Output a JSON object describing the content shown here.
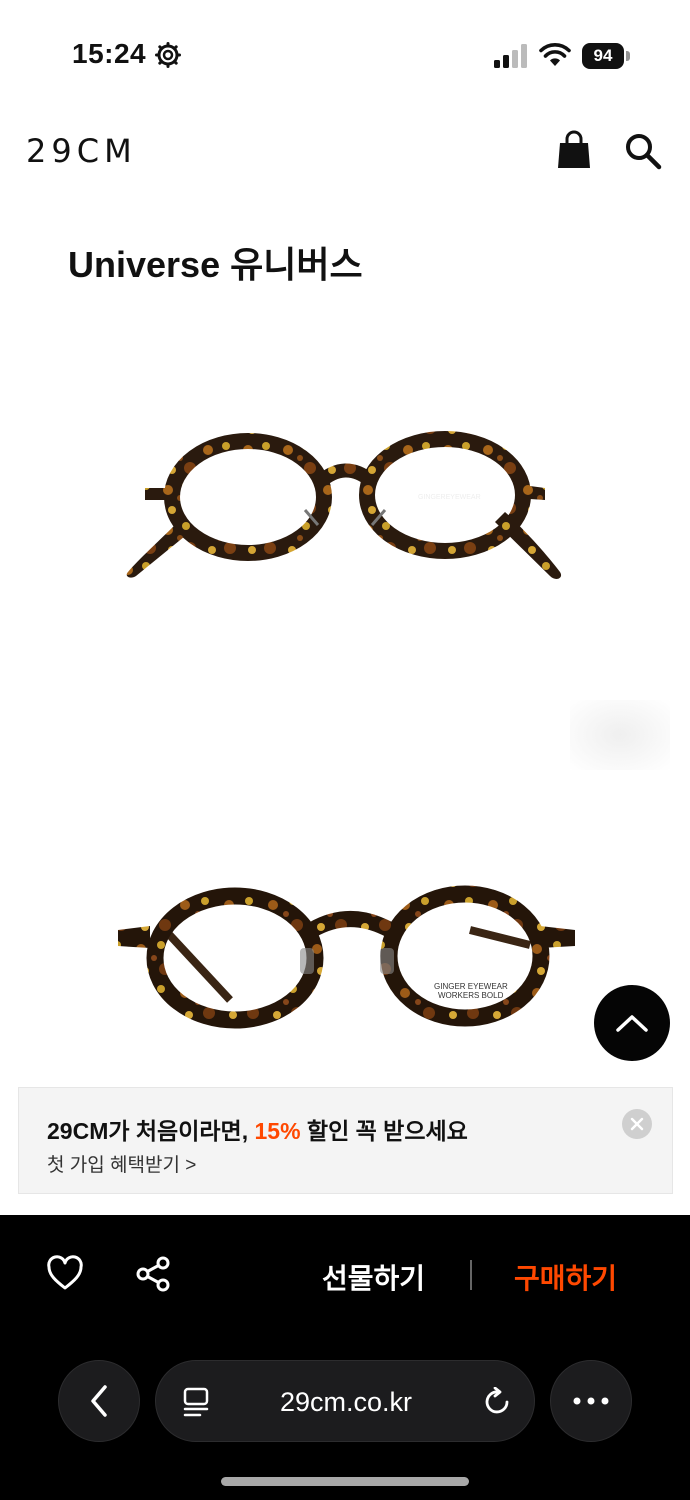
{
  "status_bar": {
    "time": "15:24",
    "battery": "94"
  },
  "header": {
    "logo": "29CM",
    "icons": [
      "shopping-bag-icon",
      "search-icon"
    ]
  },
  "product": {
    "title": "Universe 유니버스",
    "image_text_1": "GINGEREYEWEAR",
    "image_text_2a": "GINGER EYEWEAR",
    "image_text_2b": "WORKERS BOLD"
  },
  "promo": {
    "headline_prefix": "29CM가 처음이라면, ",
    "headline_highlight": "15%",
    "headline_suffix": " 할인 꼭 받으세요",
    "link": "첫 가입 혜택받기 >",
    "highlight_color": "#ff4800"
  },
  "actions": {
    "gift_label": "선물하기",
    "buy_label": "구매하기",
    "accent": "#ff4800"
  },
  "browser": {
    "url": "29cm.co.kr"
  }
}
